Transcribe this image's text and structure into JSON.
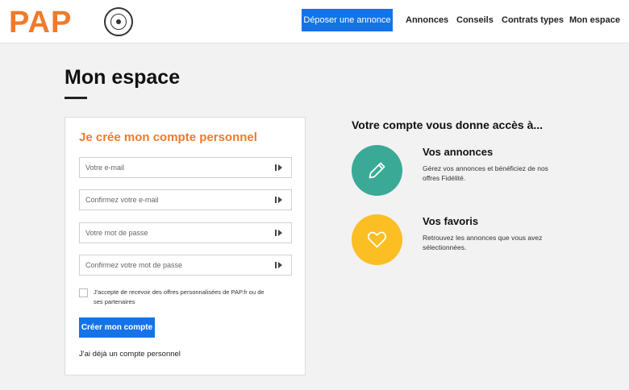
{
  "header": {
    "logo_text": "PAP",
    "cta_label": "Déposer une annonce",
    "nav": [
      "Annonces",
      "Conseils",
      "Contrats types",
      "Mon espace"
    ]
  },
  "page": {
    "title": "Mon espace"
  },
  "form": {
    "title": "Je crée mon compte personnel",
    "fields": [
      {
        "placeholder": "Votre e-mail"
      },
      {
        "placeholder": "Confirmez votre e-mail"
      },
      {
        "placeholder": "Votre mot de passe"
      },
      {
        "placeholder": "Confirmez votre mot de passe"
      }
    ],
    "consent_text": "J'accepte de recevoir des offres personnalisées de PAP.fr ou de ses partenaires",
    "submit_label": "Créer mon compte",
    "login_link": "J'ai déjà un compte personnel"
  },
  "promo": {
    "title": "Votre compte vous donne accès à...",
    "features": [
      {
        "title": "Vos annonces",
        "description": "Gérez vos annonces et bénéficiez de nos offres Fidélité.",
        "icon": "pencil-icon",
        "color": "#3aaa97"
      },
      {
        "title": "Vos favoris",
        "description": "Retrouvez les annonces que vous avez sélectionnées.",
        "icon": "heart-icon",
        "color": "#fbbf24"
      }
    ]
  },
  "colors": {
    "brand_orange": "#f07a2b",
    "primary_blue": "#1473e6"
  }
}
